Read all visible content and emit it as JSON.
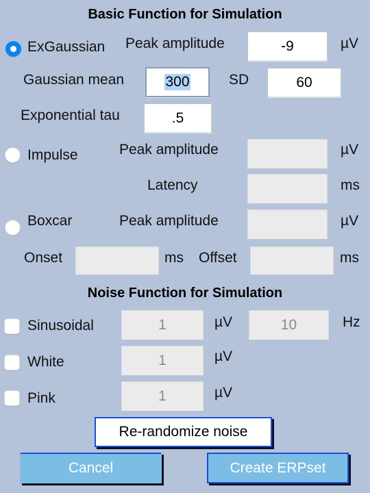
{
  "window": {
    "background_color": "#b4c3da"
  },
  "basic_section": {
    "title": "Basic Function for Simulation",
    "options": [
      {
        "id": "exgaussian",
        "label": "ExGaussian",
        "selected": true,
        "rows": [
          {
            "label": "Peak amplitude",
            "value": "-9",
            "unit": "µV",
            "enabled": true,
            "focused": false
          },
          {
            "label": "Gaussian mean",
            "value": "300",
            "unit": "",
            "enabled": true,
            "focused": true,
            "selected_text": true
          },
          {
            "label": "SD",
            "value": "60",
            "unit": "",
            "enabled": true,
            "focused": false
          },
          {
            "label": "Exponential tau",
            "value": ".5",
            "unit": "",
            "enabled": true,
            "focused": false
          }
        ]
      },
      {
        "id": "impulse",
        "label": "Impulse",
        "selected": false,
        "rows": [
          {
            "label": "Peak amplitude",
            "value": "",
            "unit": "µV",
            "enabled": false
          },
          {
            "label": "Latency",
            "value": "",
            "unit": "ms",
            "enabled": false
          }
        ]
      },
      {
        "id": "boxcar",
        "label": "Boxcar",
        "selected": false,
        "rows": [
          {
            "label": "Peak amplitude",
            "value": "",
            "unit": "µV",
            "enabled": false
          },
          {
            "label": "Onset",
            "value": "",
            "unit": "ms",
            "enabled": false
          },
          {
            "label": "Offset",
            "value": "",
            "unit": "ms",
            "enabled": false
          }
        ]
      }
    ]
  },
  "noise_section": {
    "title": "Noise Function for Simulation",
    "options": [
      {
        "id": "sinusoidal",
        "label": "Sinusoidal",
        "checked": false,
        "amplitude": "1",
        "amplitude_unit": "µV",
        "frequency": "10",
        "frequency_unit": "Hz"
      },
      {
        "id": "white",
        "label": "White",
        "checked": false,
        "amplitude": "1",
        "amplitude_unit": "µV"
      },
      {
        "id": "pink",
        "label": "Pink",
        "checked": false,
        "amplitude": "1",
        "amplitude_unit": "µV"
      }
    ],
    "rerandomize_button": "Re-randomize noise"
  },
  "footer": {
    "cancel_button": "Cancel",
    "create_button": "Create ERPset"
  }
}
